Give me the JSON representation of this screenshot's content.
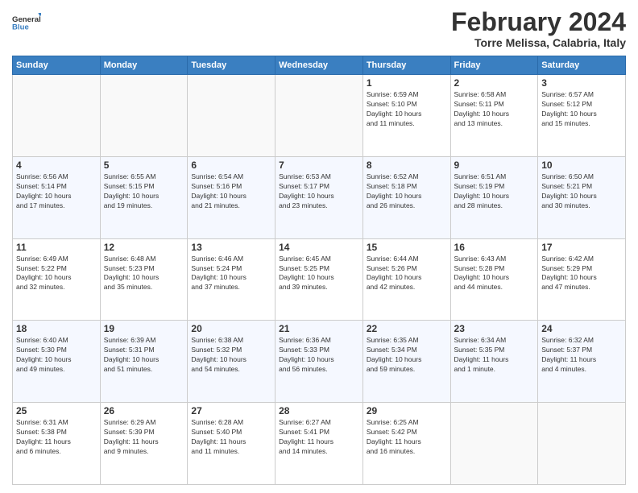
{
  "header": {
    "logo_line1": "General",
    "logo_line2": "Blue",
    "month": "February 2024",
    "location": "Torre Melissa, Calabria, Italy"
  },
  "weekdays": [
    "Sunday",
    "Monday",
    "Tuesday",
    "Wednesday",
    "Thursday",
    "Friday",
    "Saturday"
  ],
  "weeks": [
    [
      {
        "day": "",
        "info": ""
      },
      {
        "day": "",
        "info": ""
      },
      {
        "day": "",
        "info": ""
      },
      {
        "day": "",
        "info": ""
      },
      {
        "day": "1",
        "info": "Sunrise: 6:59 AM\nSunset: 5:10 PM\nDaylight: 10 hours\nand 11 minutes."
      },
      {
        "day": "2",
        "info": "Sunrise: 6:58 AM\nSunset: 5:11 PM\nDaylight: 10 hours\nand 13 minutes."
      },
      {
        "day": "3",
        "info": "Sunrise: 6:57 AM\nSunset: 5:12 PM\nDaylight: 10 hours\nand 15 minutes."
      }
    ],
    [
      {
        "day": "4",
        "info": "Sunrise: 6:56 AM\nSunset: 5:14 PM\nDaylight: 10 hours\nand 17 minutes."
      },
      {
        "day": "5",
        "info": "Sunrise: 6:55 AM\nSunset: 5:15 PM\nDaylight: 10 hours\nand 19 minutes."
      },
      {
        "day": "6",
        "info": "Sunrise: 6:54 AM\nSunset: 5:16 PM\nDaylight: 10 hours\nand 21 minutes."
      },
      {
        "day": "7",
        "info": "Sunrise: 6:53 AM\nSunset: 5:17 PM\nDaylight: 10 hours\nand 23 minutes."
      },
      {
        "day": "8",
        "info": "Sunrise: 6:52 AM\nSunset: 5:18 PM\nDaylight: 10 hours\nand 26 minutes."
      },
      {
        "day": "9",
        "info": "Sunrise: 6:51 AM\nSunset: 5:19 PM\nDaylight: 10 hours\nand 28 minutes."
      },
      {
        "day": "10",
        "info": "Sunrise: 6:50 AM\nSunset: 5:21 PM\nDaylight: 10 hours\nand 30 minutes."
      }
    ],
    [
      {
        "day": "11",
        "info": "Sunrise: 6:49 AM\nSunset: 5:22 PM\nDaylight: 10 hours\nand 32 minutes."
      },
      {
        "day": "12",
        "info": "Sunrise: 6:48 AM\nSunset: 5:23 PM\nDaylight: 10 hours\nand 35 minutes."
      },
      {
        "day": "13",
        "info": "Sunrise: 6:46 AM\nSunset: 5:24 PM\nDaylight: 10 hours\nand 37 minutes."
      },
      {
        "day": "14",
        "info": "Sunrise: 6:45 AM\nSunset: 5:25 PM\nDaylight: 10 hours\nand 39 minutes."
      },
      {
        "day": "15",
        "info": "Sunrise: 6:44 AM\nSunset: 5:26 PM\nDaylight: 10 hours\nand 42 minutes."
      },
      {
        "day": "16",
        "info": "Sunrise: 6:43 AM\nSunset: 5:28 PM\nDaylight: 10 hours\nand 44 minutes."
      },
      {
        "day": "17",
        "info": "Sunrise: 6:42 AM\nSunset: 5:29 PM\nDaylight: 10 hours\nand 47 minutes."
      }
    ],
    [
      {
        "day": "18",
        "info": "Sunrise: 6:40 AM\nSunset: 5:30 PM\nDaylight: 10 hours\nand 49 minutes."
      },
      {
        "day": "19",
        "info": "Sunrise: 6:39 AM\nSunset: 5:31 PM\nDaylight: 10 hours\nand 51 minutes."
      },
      {
        "day": "20",
        "info": "Sunrise: 6:38 AM\nSunset: 5:32 PM\nDaylight: 10 hours\nand 54 minutes."
      },
      {
        "day": "21",
        "info": "Sunrise: 6:36 AM\nSunset: 5:33 PM\nDaylight: 10 hours\nand 56 minutes."
      },
      {
        "day": "22",
        "info": "Sunrise: 6:35 AM\nSunset: 5:34 PM\nDaylight: 10 hours\nand 59 minutes."
      },
      {
        "day": "23",
        "info": "Sunrise: 6:34 AM\nSunset: 5:35 PM\nDaylight: 11 hours\nand 1 minute."
      },
      {
        "day": "24",
        "info": "Sunrise: 6:32 AM\nSunset: 5:37 PM\nDaylight: 11 hours\nand 4 minutes."
      }
    ],
    [
      {
        "day": "25",
        "info": "Sunrise: 6:31 AM\nSunset: 5:38 PM\nDaylight: 11 hours\nand 6 minutes."
      },
      {
        "day": "26",
        "info": "Sunrise: 6:29 AM\nSunset: 5:39 PM\nDaylight: 11 hours\nand 9 minutes."
      },
      {
        "day": "27",
        "info": "Sunrise: 6:28 AM\nSunset: 5:40 PM\nDaylight: 11 hours\nand 11 minutes."
      },
      {
        "day": "28",
        "info": "Sunrise: 6:27 AM\nSunset: 5:41 PM\nDaylight: 11 hours\nand 14 minutes."
      },
      {
        "day": "29",
        "info": "Sunrise: 6:25 AM\nSunset: 5:42 PM\nDaylight: 11 hours\nand 16 minutes."
      },
      {
        "day": "",
        "info": ""
      },
      {
        "day": "",
        "info": ""
      }
    ]
  ]
}
